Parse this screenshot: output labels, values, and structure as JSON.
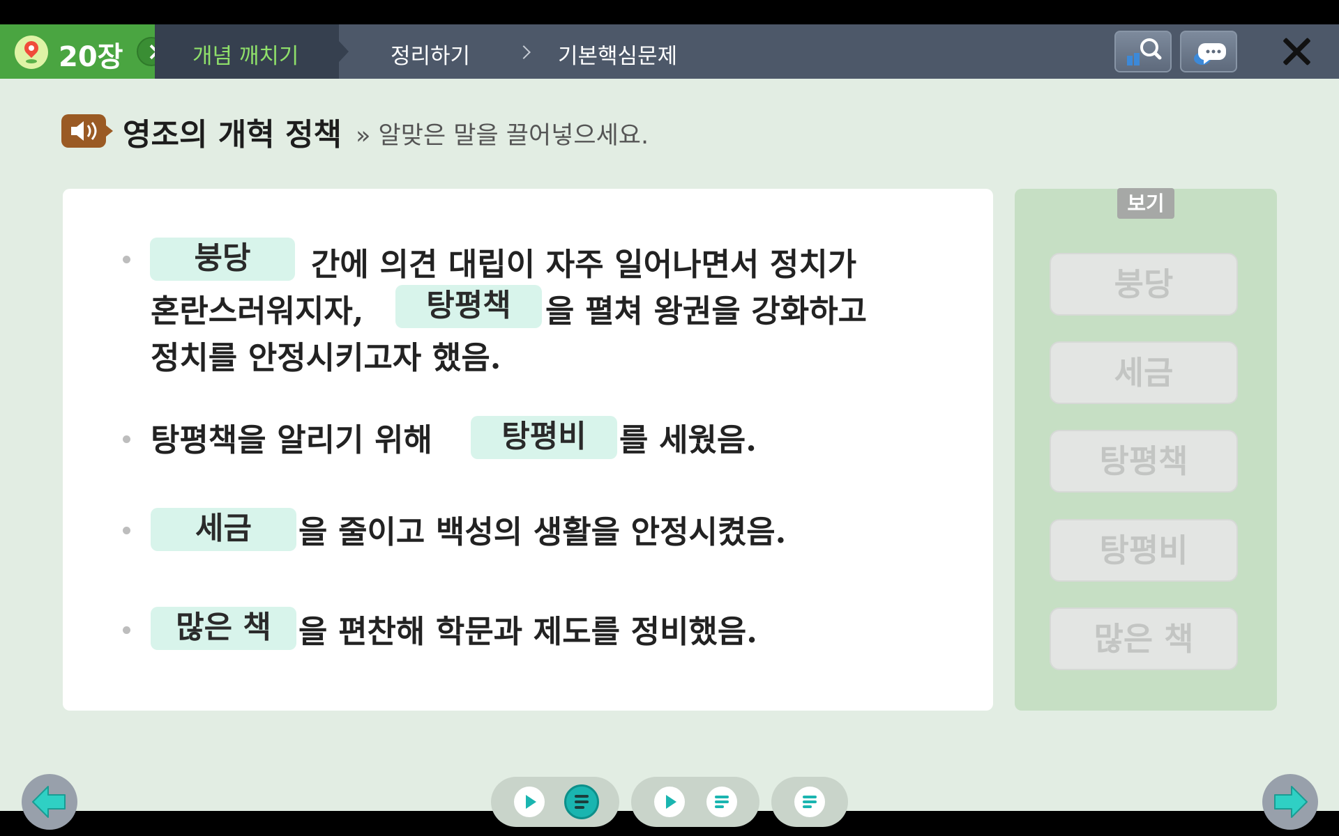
{
  "topbar": {
    "chapter_label": "20장",
    "tab_active": "개념 깨치기",
    "tabs": [
      "정리하기",
      "기본핵심문제"
    ]
  },
  "heading": {
    "title": "영조의 개혁 정책",
    "instruction": "» 알맞은 말을 끌어넣으세요."
  },
  "passage": {
    "item1": {
      "blank1": "붕당",
      "text_a": "간에 의견 대립이 자주 일어나면서 정치가",
      "text_b": "혼란스러워지자,",
      "blank2": "탕평책",
      "text_c": "을 펼쳐 왕권을 강화하고",
      "text_d": "정치를 안정시키고자 했음."
    },
    "item2": {
      "text_a": "탕평책을 알리기 위해",
      "blank": "탕평비",
      "text_b": "를 세웠음."
    },
    "item3": {
      "blank": "세금",
      "text_a": "을 줄이고 백성의 생활을 안정시켰음."
    },
    "item4": {
      "blank": "많은 책",
      "text_a": "을 편찬해 학문과 제도를 정비했음."
    }
  },
  "word_bank": {
    "label": "보기",
    "words": [
      "붕당",
      "세금",
      "탕평책",
      "탕평비",
      "많은 책"
    ]
  },
  "colors": {
    "accent": "#1ab5b0",
    "chapter_green": "#4aa541",
    "blank_fill": "#d8f4eb"
  }
}
